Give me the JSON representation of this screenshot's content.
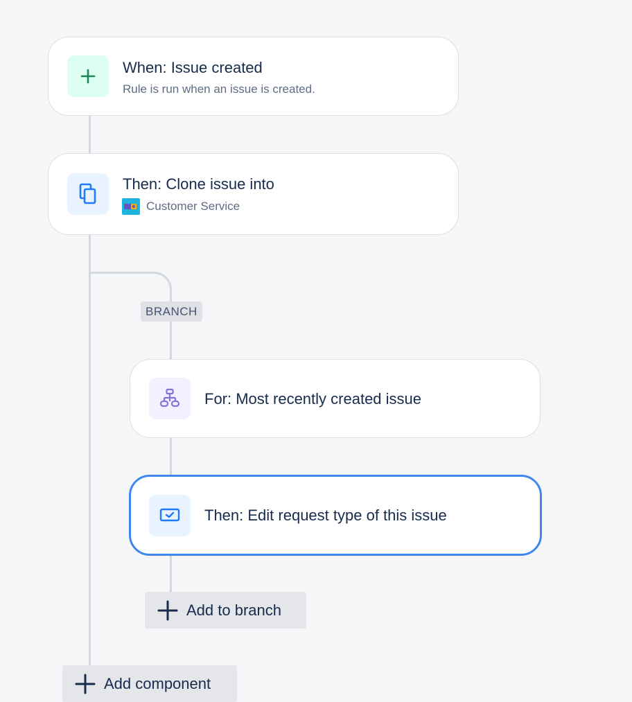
{
  "steps": [
    {
      "id": "trigger",
      "title": "When: Issue created",
      "subtitle": "Rule is run when an issue is created.",
      "icon": "plus-icon",
      "icon_bg": "#dcfff1",
      "icon_color": "#1f845a"
    },
    {
      "id": "clone",
      "title": "Then: Clone issue into",
      "subtitle": "Customer Service",
      "icon": "copy-icon",
      "icon_bg": "#e9f2ff",
      "icon_color": "#1d7afc"
    }
  ],
  "branch": {
    "tag": "BRANCH",
    "steps": [
      {
        "id": "for",
        "title": "For: Most recently created issue",
        "icon": "branch-icon",
        "icon_bg": "#f3f0ff",
        "icon_color": "#8270db"
      },
      {
        "id": "edit",
        "title": "Then: Edit request type of this issue",
        "icon": "request-type-icon",
        "icon_bg": "#e9f2ff",
        "icon_color": "#1d7afc",
        "selected": true
      }
    ],
    "add_button": "Add to branch"
  },
  "add_component_button": "Add component",
  "colors": {
    "selected_border": "#3f86ee",
    "connector": "#d4d8de"
  }
}
